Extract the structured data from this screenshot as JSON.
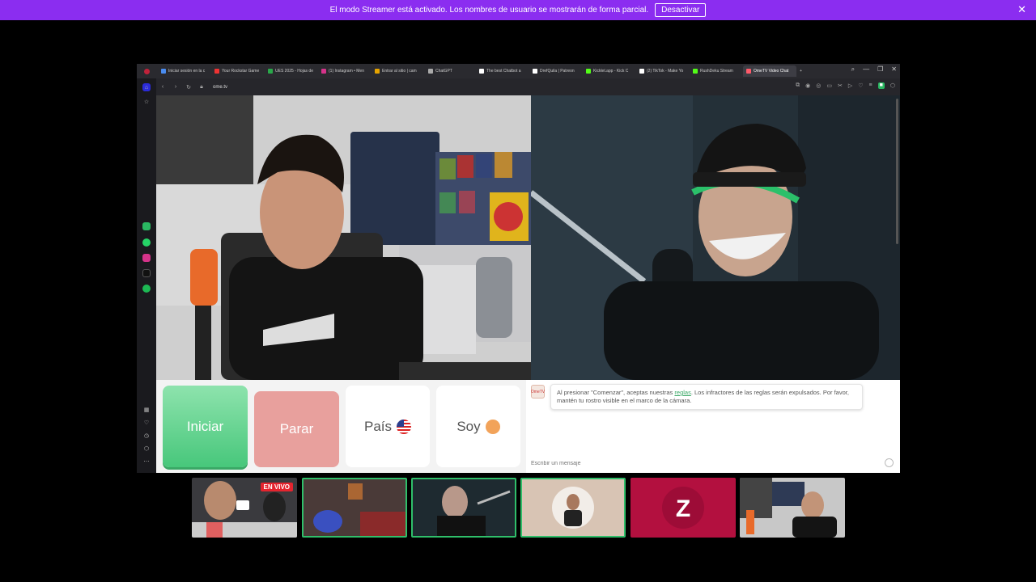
{
  "banner": {
    "message": "El modo Streamer está activado. Los nombres de usuario se mostrarán de forma parcial.",
    "button": "Desactivar",
    "close": "✕"
  },
  "tabs": [
    {
      "label": "Iniciar sesión en la c",
      "color": "#4a8cf0"
    },
    {
      "label": "Your Rockstar Game",
      "color": "#e33"
    },
    {
      "label": "UES 2025 - Hojas de",
      "color": "#2aa84a"
    },
    {
      "label": "(1) Instagram • Men",
      "color": "#d5338a"
    },
    {
      "label": "Entrar al sitio | cam",
      "color": "#e5a300"
    },
    {
      "label": "ChatGPT",
      "color": "#aaaaaa"
    },
    {
      "label": "The best Chatbot a",
      "color": "#ffffff"
    },
    {
      "label": "DrefQuila | Patreon",
      "color": "#ffffff"
    },
    {
      "label": "Kicklet.app - Kick C",
      "color": "#53fc18"
    },
    {
      "label": "(2) TikTok - Make Yo",
      "color": "#ffffff"
    },
    {
      "label": "RushDeku Stream",
      "color": "#53fc18"
    },
    {
      "label": "OmeTV Video Chat",
      "color": "#ff5a6a"
    }
  ],
  "address": {
    "url": "ome.tv"
  },
  "controls": {
    "start": "Iniciar",
    "stop": "Parar",
    "country": "País",
    "me": "Soy"
  },
  "chat": {
    "logo": "OmeTV",
    "msg_before": "Al presionar \"Comenzar\", aceptas nuestras ",
    "msg_link": "reglas",
    "msg_after": ". Los infractores de las reglas serán expulsados. Por favor, mantén tu rostro visible en el marco de la cámara.",
    "placeholder": "Escribir un mensaje"
  },
  "thumbnails": {
    "live_badge": "EN VIVO"
  }
}
